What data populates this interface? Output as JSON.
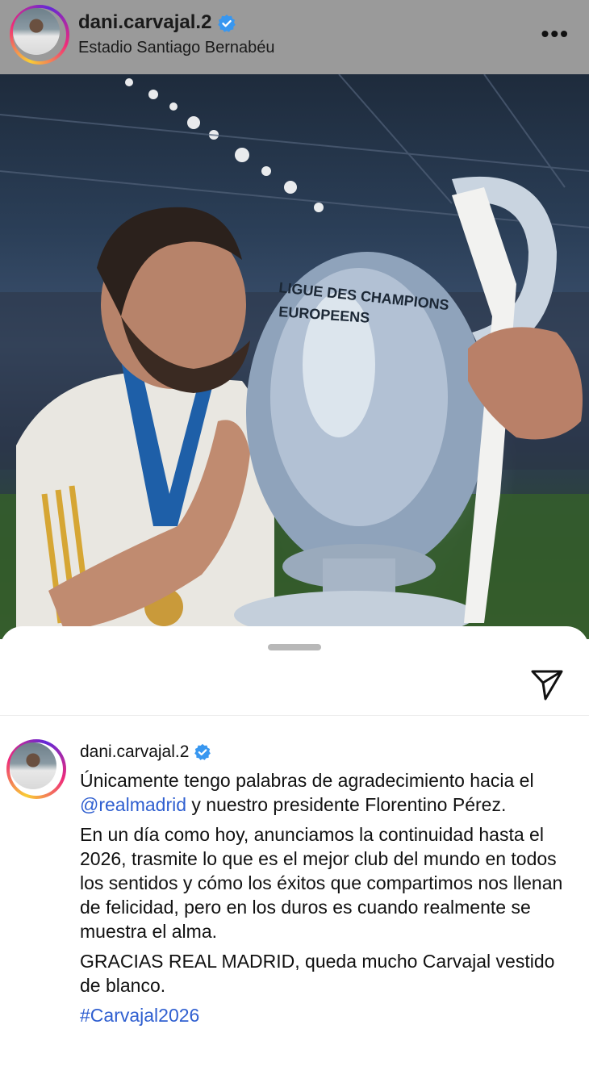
{
  "header": {
    "username": "dani.carvajal.2",
    "location": "Estadio Santiago Bernabéu",
    "more_icon": "more-horizontal-icon",
    "verified_icon": "verified-badge-icon"
  },
  "sheet": {
    "share_icon": "send-icon",
    "username": "dani.carvajal.2",
    "caption": {
      "p1_before": "Únicamente tengo palabras de agradecimiento hacia el ",
      "p1_mention": "@realmadrid",
      "p1_after": " y nuestro presidente Florentino Pérez.",
      "p2": "En un día como hoy, anunciamos la continuidad hasta el 2026, trasmite lo que es el mejor club del mundo en todos los sentidos y cómo los éxitos que compartimos nos llenan de felicidad, pero en los duros es cuando realmente se muestra el alma.",
      "p3": "GRACIAS REAL MADRID, queda mucho Carvajal vestido de blanco.",
      "hashtag": "#Carvajal2026"
    }
  },
  "photo": {
    "trophy_text_1": "LIGUE DES CHAMPIONS",
    "trophy_text_2": "EUROPEENS"
  },
  "colors": {
    "verified": "#3897f0",
    "link": "#2f5fd0",
    "header_dim": "#9a9a9a"
  }
}
